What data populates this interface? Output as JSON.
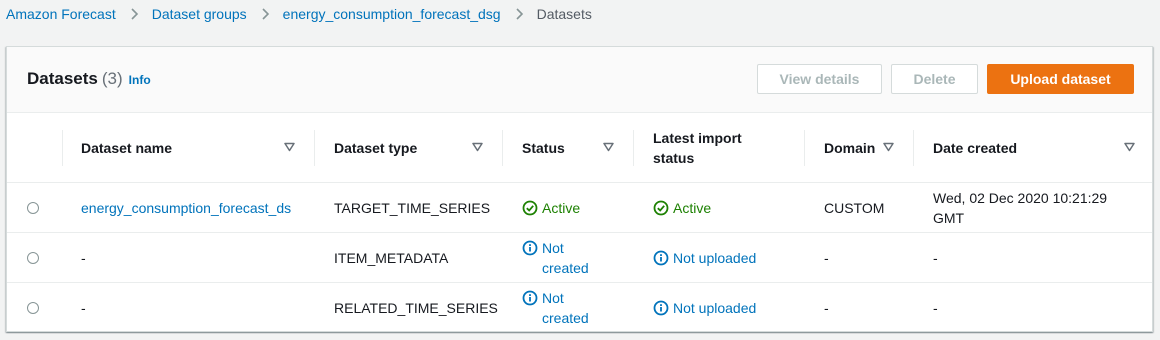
{
  "breadcrumb": {
    "items": [
      "Amazon Forecast",
      "Dataset groups",
      "energy_consumption_forecast_dsg"
    ],
    "current": "Datasets"
  },
  "panel": {
    "title": "Datasets",
    "count": "(3)",
    "info": "Info",
    "buttons": {
      "view_details": "View details",
      "delete": "Delete",
      "upload": "Upload dataset"
    }
  },
  "table": {
    "columns": {
      "name": "Dataset name",
      "type": "Dataset type",
      "status": "Status",
      "import_status": "Latest import status",
      "domain": "Domain",
      "date": "Date created"
    },
    "rows": [
      {
        "name": "energy_consumption_forecast_ds",
        "type": "TARGET_TIME_SERIES",
        "status": "Active",
        "import_status": "Active",
        "domain": "CUSTOM",
        "date": "Wed, 02 Dec 2020 10:21:29 GMT"
      },
      {
        "name": "-",
        "type": "ITEM_METADATA",
        "status": "Not created",
        "import_status": "Not uploaded",
        "domain": "-",
        "date": "-"
      },
      {
        "name": "-",
        "type": "RELATED_TIME_SERIES",
        "status": "Not created",
        "import_status": "Not uploaded",
        "domain": "-",
        "date": "-"
      }
    ]
  },
  "colors": {
    "link": "#0073bb",
    "success": "#1d8102",
    "primary_button": "#ec7211",
    "disabled_text": "#aab7b8"
  }
}
